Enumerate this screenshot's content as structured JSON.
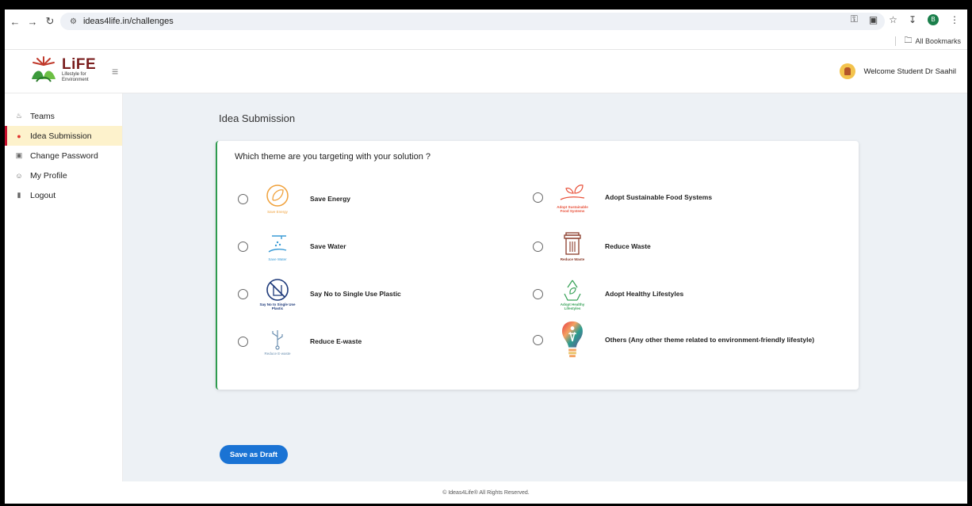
{
  "browser": {
    "url": "ideas4life.in/challenges",
    "bookmarks_label": "All Bookmarks",
    "profile_initial": "B"
  },
  "header": {
    "logo_title": "LiFE",
    "logo_subtitle_line1": "Lifestyle for",
    "logo_subtitle_line2": "Environment",
    "welcome_text": "Welcome Student Dr Saahil"
  },
  "sidebar": {
    "items": [
      {
        "label": "Teams",
        "icon": "teams-icon",
        "active": false
      },
      {
        "label": "Idea Submission",
        "icon": "bulb-icon",
        "active": true
      },
      {
        "label": "Change Password",
        "icon": "lock-icon",
        "active": false
      },
      {
        "label": "My Profile",
        "icon": "profile-icon",
        "active": false
      },
      {
        "label": "Logout",
        "icon": "logout-icon",
        "active": false
      }
    ]
  },
  "main": {
    "page_title": "Idea Submission",
    "question": "Which theme are you targeting with your solution ?",
    "options": [
      {
        "label": "Save Energy",
        "caption": "Save Energy",
        "icon": "save-energy-icon"
      },
      {
        "label": "Save Water",
        "caption": "Save Water",
        "icon": "save-water-icon"
      },
      {
        "label": "Say No to Single Use Plastic",
        "caption": "Say No to Single Use Plastic",
        "icon": "no-plastic-icon"
      },
      {
        "label": "Reduce E-waste",
        "caption": "Reduce E-waste",
        "icon": "e-waste-icon"
      },
      {
        "label": "Adopt Sustainable Food Systems",
        "caption": "Adopt Sustainable Food Systems",
        "icon": "food-systems-icon"
      },
      {
        "label": "Reduce Waste",
        "caption": "Reduce Waste",
        "icon": "waste-bin-icon"
      },
      {
        "label": "Adopt Healthy Lifestyles",
        "caption": "Adopt Healthy Lifestyles",
        "icon": "healthy-lifestyle-icon"
      },
      {
        "label": "Others (Any other theme related to environment-friendly lifestyle)",
        "caption": "",
        "icon": "others-bulb-icon"
      }
    ],
    "save_button": "Save as Draft"
  },
  "footer": {
    "text": "© Ideas4Life® All Rights Reserved."
  },
  "colors": {
    "accent": "#1a73d4",
    "active_bg": "#fdf2cc",
    "active_bar": "#c8102e",
    "card_border": "#2e9b4f",
    "main_bg": "#edf1f5"
  }
}
